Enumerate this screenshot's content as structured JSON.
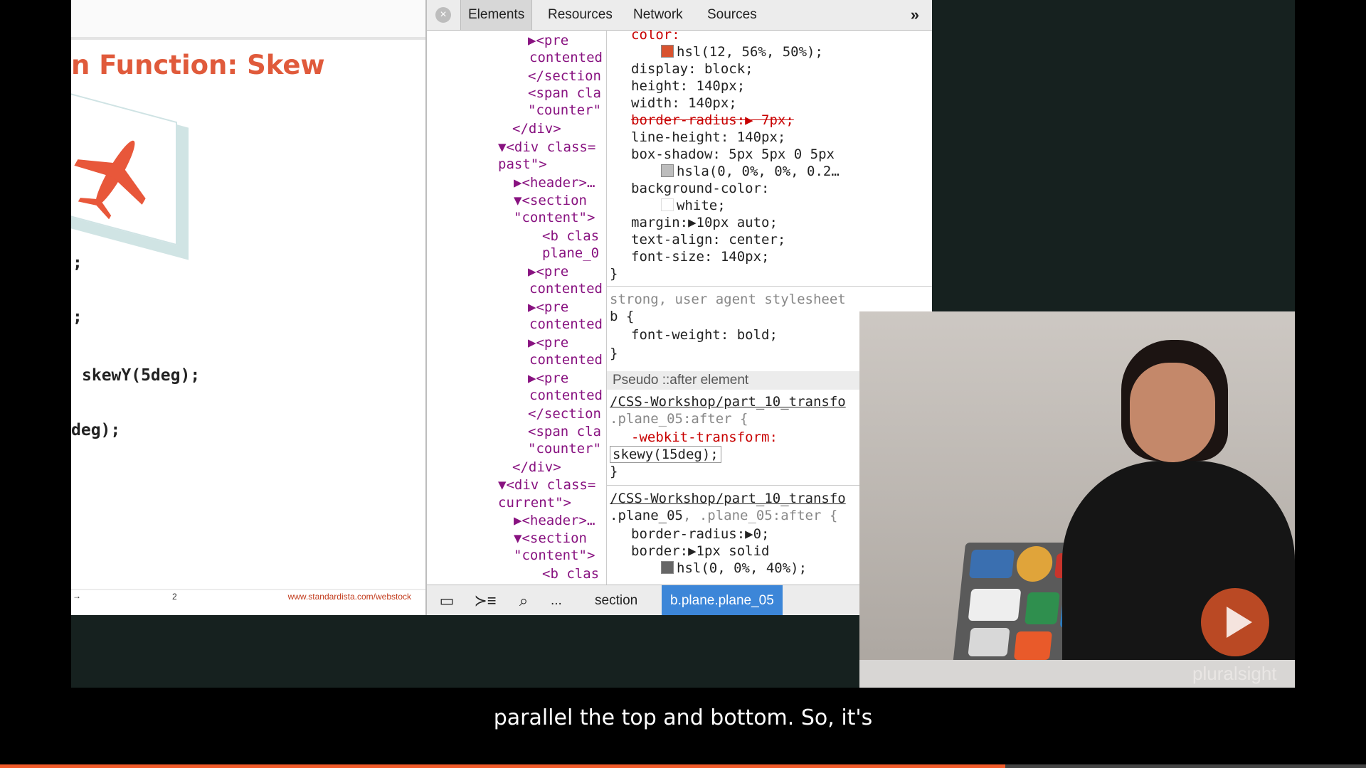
{
  "slide": {
    "title": "n Function: Skew",
    "code_lines": [
      ";",
      ";",
      "skewY(5deg);",
      "deg);"
    ],
    "footer_arrow": "→",
    "footer_page": "2",
    "footer_url": "www.standardista.com/webstock"
  },
  "devtools": {
    "close_icon": "×",
    "tabs": [
      "Elements",
      "Resources",
      "Network",
      "Sources"
    ],
    "more": "»",
    "dom_lines": [
      "▶<pre",
      "contented",
      "</section",
      "<span cla",
      "\"counter\"",
      "</div>",
      "▼<div class=",
      "past\">",
      "▶<header>…",
      "▼<section",
      "\"content\">",
      "<b clas",
      "plane_0",
      "▶<pre",
      "contented",
      "▶<pre",
      "contented",
      "▶<pre",
      "contented",
      "▶<pre",
      "contented",
      "</section",
      "<span cla",
      "\"counter\"",
      "</div>",
      "▼<div class=",
      "current\">",
      "▶<header>…",
      "▼<section",
      "\"content\">",
      "<b clas"
    ],
    "styles": {
      "rule1": {
        "color_prop": "color:",
        "color_val": "hsl(12, 56%, 50%);",
        "display": "display: block;",
        "height": "height: 140px;",
        "width": "width: 140px;",
        "border_radius": "border-radius:▶ 7px;",
        "line_height": "line-height: 140px;",
        "box_shadow": "box-shadow: 5px 5px 0 5px",
        "box_shadow_val": "hsla(0, 0%, 0%, 0.2…",
        "bg_prop": "background-color:",
        "bg_val": "white;",
        "margin": "margin:▶10px auto;",
        "text_align": "text-align: center;",
        "font_size": "font-size: 140px;",
        "close": "}"
      },
      "ua_header": "strong, user agent stylesheet",
      "ua_selector": "b {",
      "ua_font_weight": "font-weight: bold;",
      "ua_close": "}",
      "pseudo_header": "Pseudo ::after element",
      "source_link_1": "/CSS-Workshop/part_10_transfo",
      "pseudo_selector": ".plane_05:after {",
      "webkit_transform": "-webkit-transform:",
      "edit_value": "skewy(15deg);",
      "pseudo_close": "}",
      "source_link_2": "/CSS-Workshop/part_10_transfo",
      "rule3_selector_a": ".plane_05",
      "rule3_selector_b": ", .plane_05:after {",
      "rule3_border_radius": "border-radius:▶0;",
      "rule3_border": "border:▶1px solid",
      "rule3_border_val": "hsl(0, 0%, 40%);"
    },
    "swatch_colors": {
      "accent": "#d8532f",
      "shadow": "#bdbdbd",
      "white": "#ffffff",
      "gray": "#666666"
    },
    "bottom_icons": [
      "dock-icon",
      "console-icon",
      "search-icon"
    ],
    "bottom_glyphs": [
      "▭",
      "≻≡",
      "⌕"
    ],
    "crumb_ellipsis": "...",
    "crumb_section": "section",
    "crumb_active": "b.plane.plane_05",
    "gear": "⚙"
  },
  "video": {
    "brand": "pluralsight",
    "accent": "#f15b2a"
  },
  "subtitle": "parallel the top and bottom. So, it's",
  "progress": {
    "fraction": 0.736
  }
}
